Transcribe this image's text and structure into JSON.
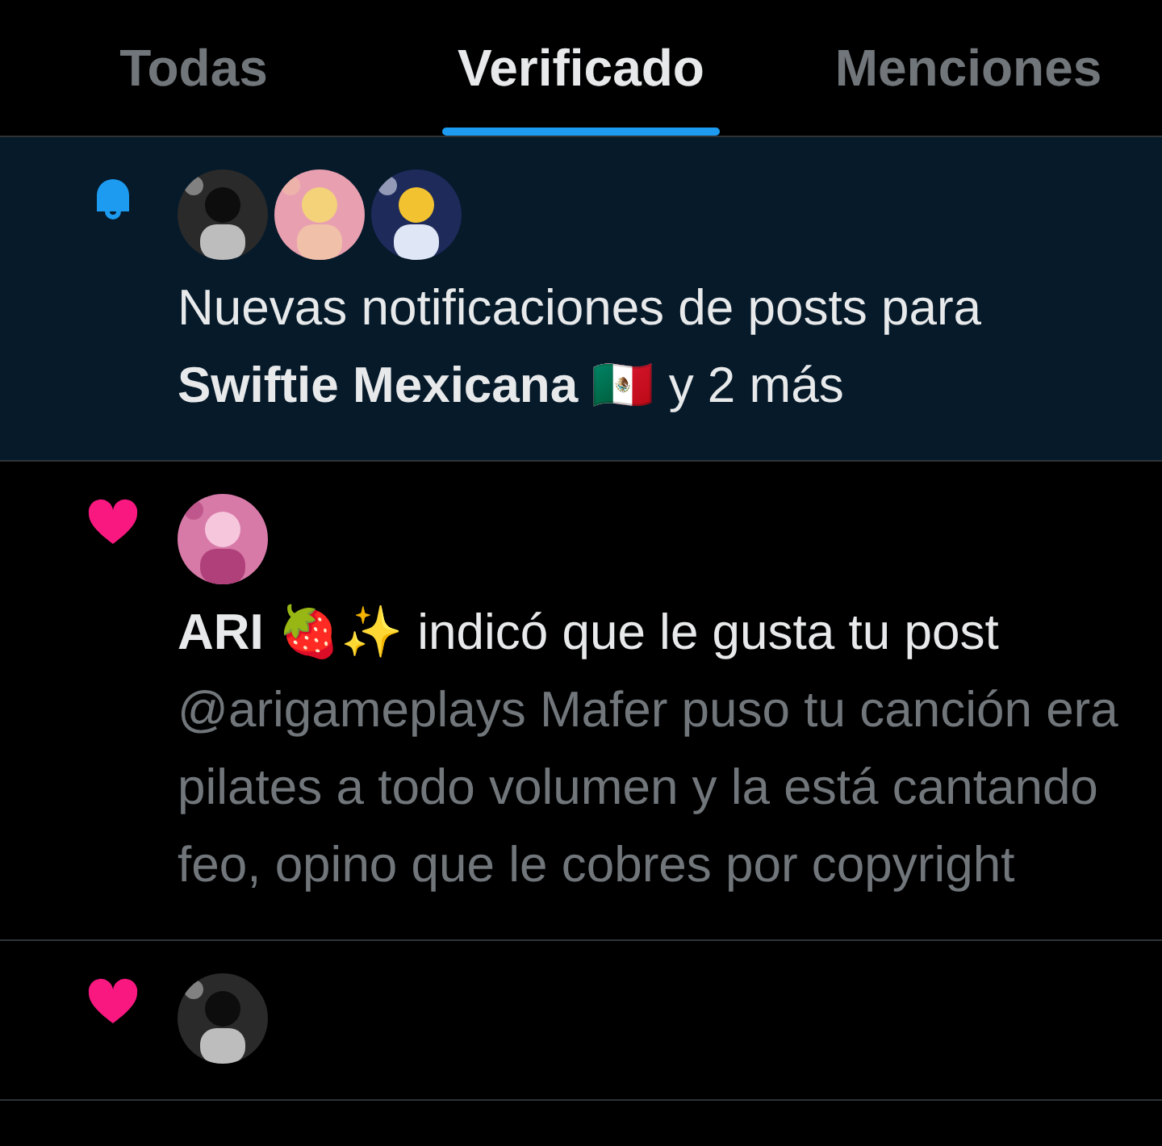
{
  "tabs": [
    {
      "label": "Todas",
      "selected": false
    },
    {
      "label": "Verificado",
      "selected": true
    },
    {
      "label": "Menciones",
      "selected": false
    }
  ],
  "notifications": [
    {
      "kind": "posts",
      "unread": true,
      "text": "Nuevas notificaciones de posts para **Swiftie Mexicana** 🇲🇽 y 2 más"
    },
    {
      "kind": "like",
      "unread": false,
      "text": "**ARI** 🍓✨ indicó que le gusta tu post",
      "excerpt": "@arigameplays Mafer puso tu canción era pilates a todo volumen y la está cantando feo, opino que le cobres por copyright"
    },
    {
      "kind": "like",
      "unread": false
    }
  ]
}
